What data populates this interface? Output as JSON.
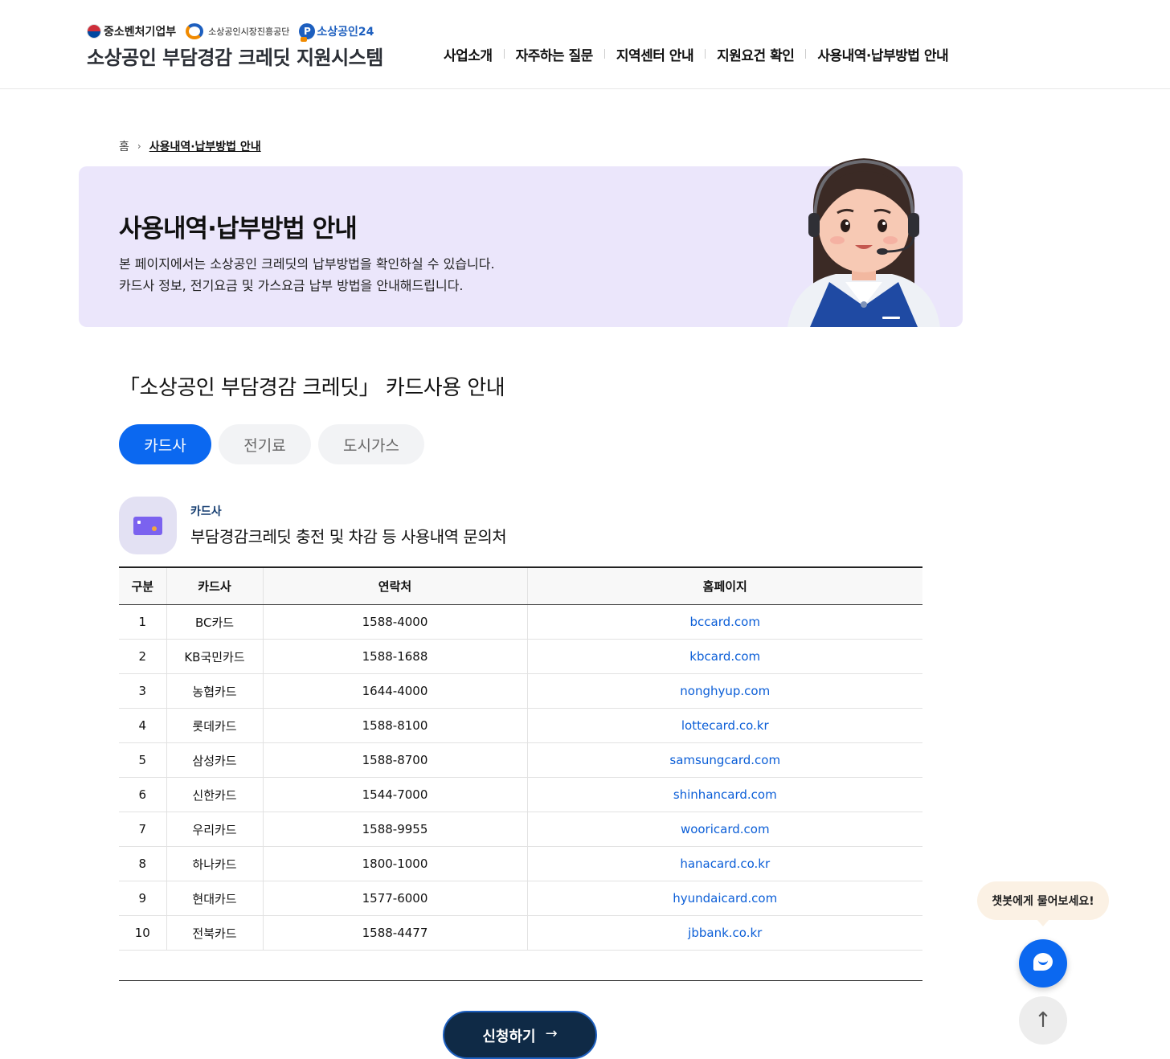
{
  "header": {
    "logos": {
      "ministry": "중소벤처기업부",
      "agency": "소상공인시장진흥공단",
      "portal": "소상공인24"
    },
    "site_title": "소상공인 부담경감 크레딧 지원시스템",
    "nav": [
      "사업소개",
      "자주하는 질문",
      "지역센터 안내",
      "지원요건 확인",
      "사용내역·납부방법 안내"
    ]
  },
  "breadcrumb": {
    "home": "홈",
    "current": "사용내역·납부방법 안내"
  },
  "hero": {
    "title": "사용내역·납부방법 안내",
    "desc_line1": "본 페이지에서는 소상공인 크레딧의 납부방법을 확인하실 수 있습니다.",
    "desc_line2": "카드사 정보, 전기요금 및 가스요금 납부 방법을 안내해드립니다."
  },
  "section": {
    "title": "「소상공인 부담경감 크레딧」 카드사용 안내",
    "tabs": [
      "카드사",
      "전기료",
      "도시가스"
    ],
    "active_tab": "카드사",
    "sub_label": "카드사",
    "sub_title": "부담경감크레딧 충전 및 차감 등 사용내역 문의처"
  },
  "table": {
    "headers": [
      "구분",
      "카드사",
      "연락처",
      "홈페이지"
    ],
    "rows": [
      [
        "1",
        "BC카드",
        "1588-4000",
        "bccard.com"
      ],
      [
        "2",
        "KB국민카드",
        "1588-1688",
        "kbcard.com"
      ],
      [
        "3",
        "농협카드",
        "1644-4000",
        "nonghyup.com"
      ],
      [
        "4",
        "롯데카드",
        "1588-8100",
        "lottecard.co.kr"
      ],
      [
        "5",
        "삼성카드",
        "1588-8700",
        "samsungcard.com"
      ],
      [
        "6",
        "신한카드",
        "1544-7000",
        "shinhancard.com"
      ],
      [
        "7",
        "우리카드",
        "1588-9955",
        "wooricard.com"
      ],
      [
        "8",
        "하나카드",
        "1800-1000",
        "hanacard.co.kr"
      ],
      [
        "9",
        "현대카드",
        "1577-6000",
        "hyundaicard.com"
      ],
      [
        "10",
        "전북카드",
        "1588-4477",
        "jbbank.co.kr"
      ]
    ]
  },
  "apply_button": {
    "label": "신청하기",
    "arrow": "→"
  },
  "chatbot": {
    "bubble": "챗봇에게 물어보세요!",
    "icon": "chat-icon"
  },
  "top_button": {
    "icon": "arrow-up-icon",
    "glyph": "↑"
  },
  "colors": {
    "accent": "#0b68f0",
    "hero_bg": "#ebe6fb",
    "link": "#0b5ed7",
    "apply_bg": "#0f2a46"
  }
}
